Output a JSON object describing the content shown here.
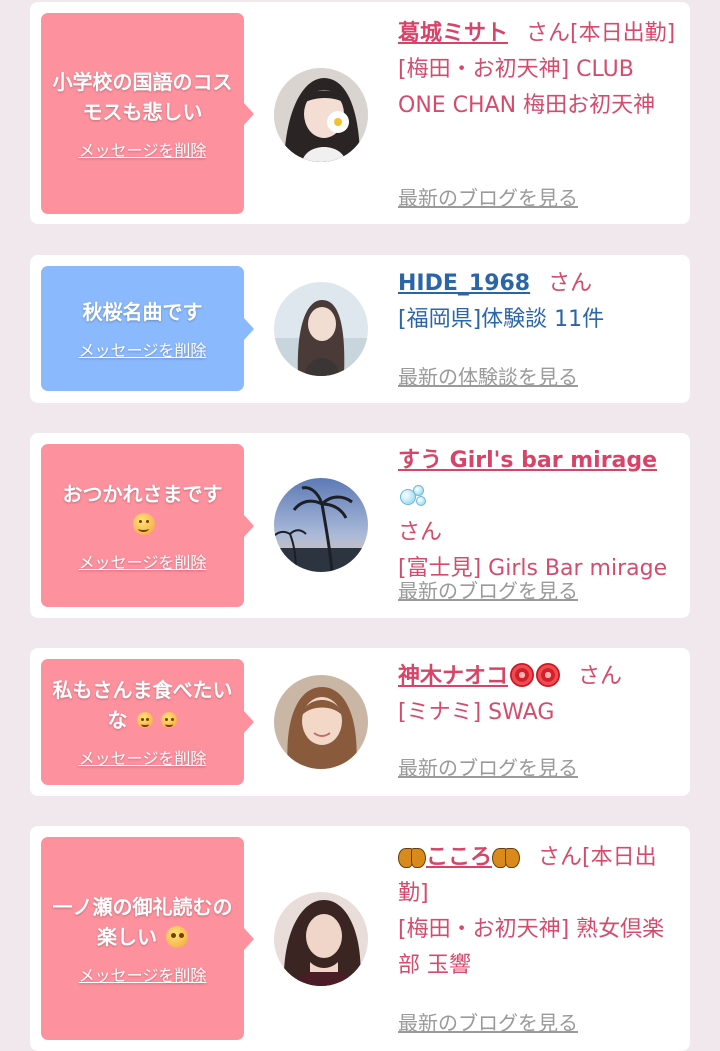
{
  "delete_label": "メッセージを削除",
  "san_label": "さん",
  "items": [
    {
      "message": "小学校の国語のコスモスも悲しい",
      "bubble_color": "#fe919e",
      "name": "葛城ミサト",
      "suffix": "[本日出勤]",
      "shop": "[梅田・お初天神] CLUB ONE CHAN 梅田お初天神",
      "link": "最新のブログを見る",
      "avatar_icon": "portrait-with-flower-icon"
    },
    {
      "message": "秋桜名曲です",
      "bubble_color": "#8bb9fd",
      "name": "HIDE_1968",
      "suffix": "",
      "shop": "[福岡県]体験談 11件",
      "link": "最新の体験談を見る",
      "avatar_icon": "portrait-icon"
    },
    {
      "message": "おつかれさまです",
      "bubble_color": "#fe919e",
      "name": "すう Girl's bar mirage",
      "suffix": "",
      "shop": "[富士見] Girls Bar mirage",
      "link": "最新のブログを見る",
      "avatar_icon": "palm-tree-sunset-icon"
    },
    {
      "message": "私もさんま食べたいな",
      "bubble_color": "#fe919e",
      "name": "神木ナオコ",
      "suffix": "",
      "shop": "[ミナミ] SWAG",
      "link": "最新のブログを見る",
      "avatar_icon": "portrait-icon"
    },
    {
      "message": "一ノ瀬の御礼読むの楽しい",
      "bubble_color": "#fe919e",
      "name": "こころ",
      "suffix": "[本日出勤]",
      "shop": "[梅田・お初天神] 熟女倶楽部 玉響",
      "link": "最新のブログを見る",
      "avatar_icon": "portrait-icon"
    }
  ]
}
